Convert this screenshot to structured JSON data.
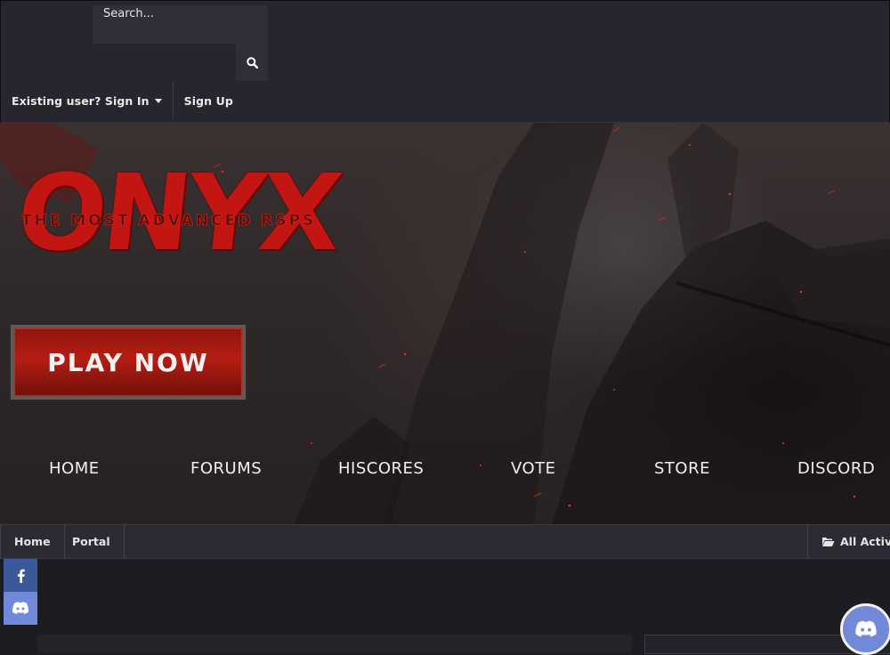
{
  "header": {
    "search": {
      "placeholder": "Search..."
    },
    "user_links": {
      "sign_in": "Existing user? Sign In",
      "sign_up": "Sign Up"
    }
  },
  "hero": {
    "logo": {
      "word": "ONYX",
      "tagline": "THE MOST ADVANCED RSPS"
    },
    "play_button": "PLAY NOW",
    "nav": [
      "HOME",
      "FORUMS",
      "HISCORES",
      "VOTE",
      "STORE",
      "DISCORD"
    ]
  },
  "breadcrumb": {
    "items": [
      "Home",
      "Portal"
    ],
    "activity_label": "All Activity"
  },
  "social": {
    "items": [
      "facebook-icon",
      "discord-icon"
    ]
  },
  "colors": {
    "accent": "#c31512",
    "facebook": "#3b5898",
    "discord": "#7289da",
    "bar": "#25262e"
  }
}
